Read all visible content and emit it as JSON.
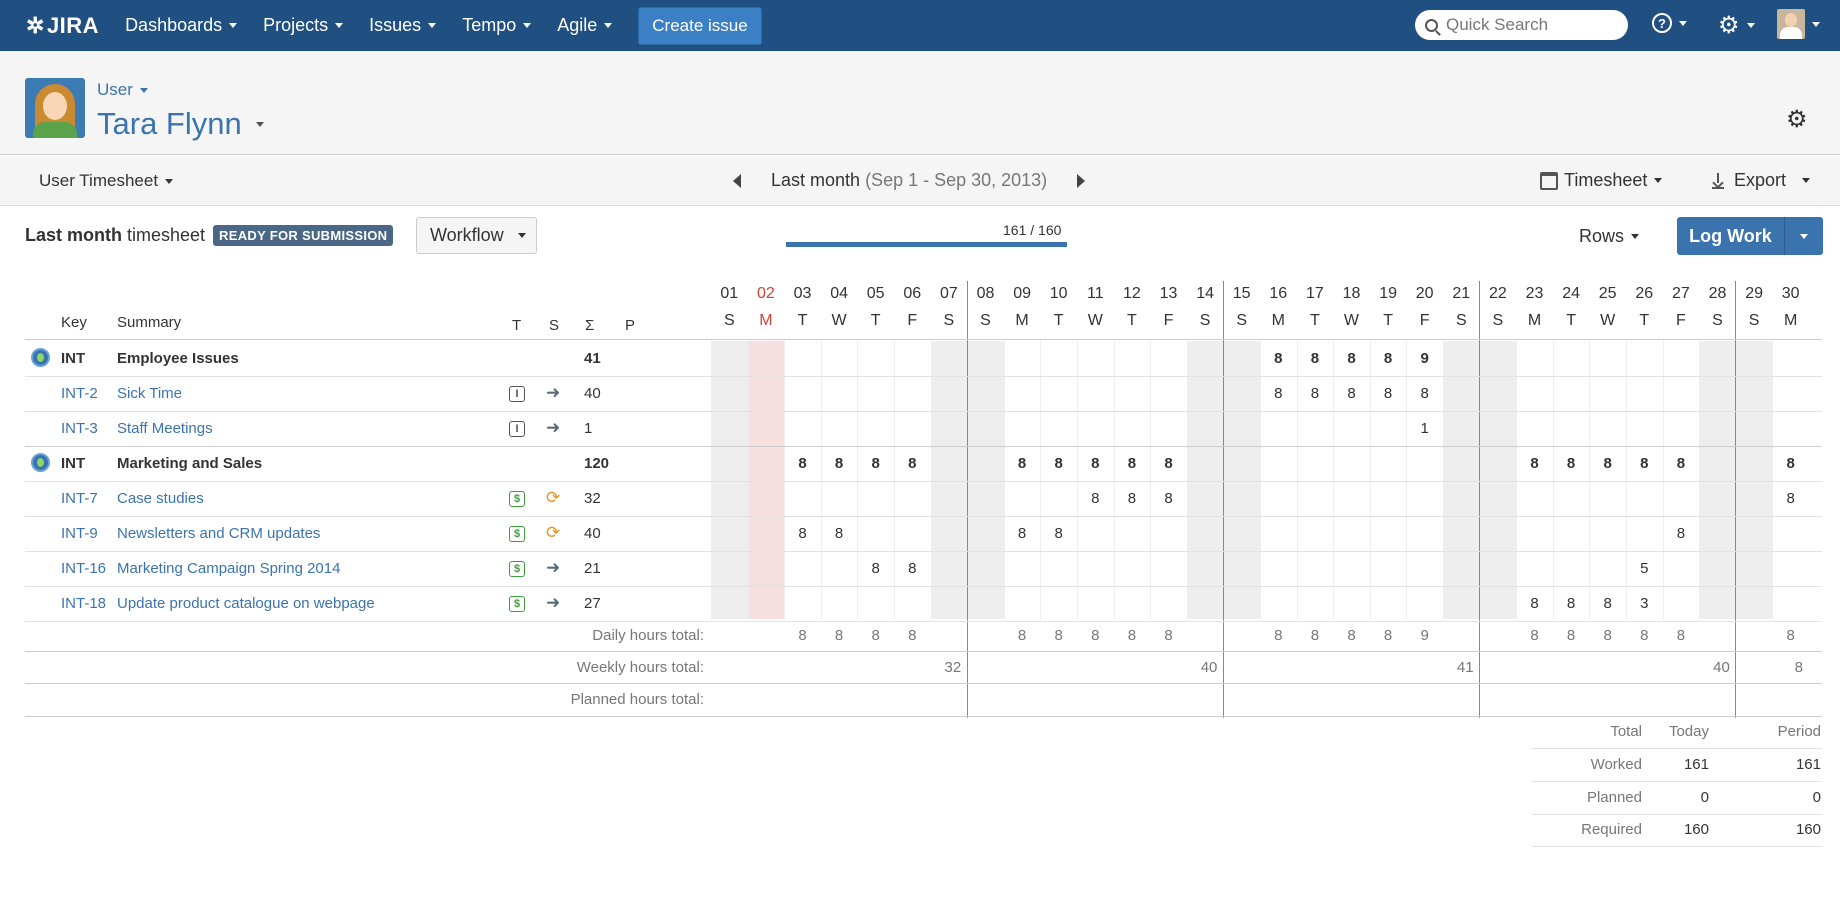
{
  "nav": {
    "logo": "JIRA",
    "items": [
      "Dashboards",
      "Projects",
      "Issues",
      "Tempo",
      "Agile"
    ],
    "create": "Create issue",
    "search_placeholder": "Quick Search"
  },
  "header": {
    "role": "User",
    "name": "Tara Flynn"
  },
  "subbar": {
    "view": "User Timesheet",
    "period": "Last month",
    "range": "(Sep 1 - Sep 30, 2013)",
    "timesheet": "Timesheet",
    "export": "Export"
  },
  "timesheet": {
    "title_bold": "Last month",
    "title_rest": "timesheet",
    "badge": "READY FOR SUBMISSION",
    "workflow": "Workflow",
    "progress_label": "161 / 160",
    "progress_fraction": 1.0,
    "rows_label": "Rows",
    "log_work": "Log Work"
  },
  "columns": {
    "key": "Key",
    "summary": "Summary",
    "t": "T",
    "s": "S",
    "sigma": "Σ",
    "p": "P"
  },
  "days": [
    {
      "d": "01",
      "w": "S",
      "type": "weekend"
    },
    {
      "d": "02",
      "w": "M",
      "type": "holiday"
    },
    {
      "d": "03",
      "w": "T"
    },
    {
      "d": "04",
      "w": "W"
    },
    {
      "d": "05",
      "w": "T"
    },
    {
      "d": "06",
      "w": "F"
    },
    {
      "d": "07",
      "w": "S",
      "type": "weekend"
    },
    {
      "d": "08",
      "w": "S",
      "type": "weekend"
    },
    {
      "d": "09",
      "w": "M"
    },
    {
      "d": "10",
      "w": "T"
    },
    {
      "d": "11",
      "w": "W"
    },
    {
      "d": "12",
      "w": "T"
    },
    {
      "d": "13",
      "w": "F"
    },
    {
      "d": "14",
      "w": "S",
      "type": "weekend"
    },
    {
      "d": "15",
      "w": "S",
      "type": "weekend"
    },
    {
      "d": "16",
      "w": "M"
    },
    {
      "d": "17",
      "w": "T"
    },
    {
      "d": "18",
      "w": "W"
    },
    {
      "d": "19",
      "w": "T"
    },
    {
      "d": "20",
      "w": "F"
    },
    {
      "d": "21",
      "w": "S",
      "type": "weekend"
    },
    {
      "d": "22",
      "w": "S",
      "type": "weekend"
    },
    {
      "d": "23",
      "w": "M"
    },
    {
      "d": "24",
      "w": "T"
    },
    {
      "d": "25",
      "w": "W"
    },
    {
      "d": "26",
      "w": "T"
    },
    {
      "d": "27",
      "w": "F"
    },
    {
      "d": "28",
      "w": "S",
      "type": "weekend"
    },
    {
      "d": "29",
      "w": "S",
      "type": "weekend"
    },
    {
      "d": "30",
      "w": "M"
    }
  ],
  "rows": [
    {
      "group": true,
      "key": "INT",
      "summary": "Employee Issues",
      "total": "41",
      "hours": {
        "16": "8",
        "17": "8",
        "18": "8",
        "19": "8",
        "20": "9"
      }
    },
    {
      "key": "INT-2",
      "summary": "Sick Time",
      "t": "I",
      "s": "person",
      "total": "40",
      "hours": {
        "16": "8",
        "17": "8",
        "18": "8",
        "19": "8",
        "20": "8"
      }
    },
    {
      "key": "INT-3",
      "summary": "Staff Meetings",
      "t": "I",
      "s": "person",
      "total": "1",
      "hours": {
        "20": "1"
      }
    },
    {
      "group": true,
      "key": "INT",
      "summary": "Marketing and Sales",
      "total": "120",
      "hours": {
        "03": "8",
        "04": "8",
        "05": "8",
        "06": "8",
        "09": "8",
        "10": "8",
        "11": "8",
        "12": "8",
        "13": "8",
        "23": "8",
        "24": "8",
        "25": "8",
        "26": "8",
        "27": "8",
        "30": "8"
      }
    },
    {
      "key": "INT-7",
      "summary": "Case studies",
      "t": "$",
      "s": "orange",
      "total": "32",
      "hours": {
        "11": "8",
        "12": "8",
        "13": "8",
        "30": "8"
      }
    },
    {
      "key": "INT-9",
      "summary": "Newsletters and CRM updates",
      "t": "$",
      "s": "orange",
      "total": "40",
      "hours": {
        "03": "8",
        "04": "8",
        "09": "8",
        "10": "8",
        "27": "8"
      }
    },
    {
      "key": "INT-16",
      "summary": "Marketing Campaign Spring 2014",
      "t": "$",
      "s": "person",
      "total": "21",
      "hours": {
        "05": "8",
        "06": "8",
        "26": "5"
      }
    },
    {
      "key": "INT-18",
      "summary": "Update product catalogue on webpage",
      "t": "$",
      "s": "person",
      "total": "27",
      "hours": {
        "23": "8",
        "24": "8",
        "25": "8",
        "26": "3"
      }
    }
  ],
  "footer": {
    "daily_label": "Daily hours total:",
    "weekly_label": "Weekly hours total:",
    "planned_label": "Planned hours total:",
    "daily": {
      "03": "8",
      "04": "8",
      "05": "8",
      "06": "8",
      "09": "8",
      "10": "8",
      "11": "8",
      "12": "8",
      "13": "8",
      "16": "8",
      "17": "8",
      "18": "8",
      "19": "8",
      "20": "9",
      "23": "8",
      "24": "8",
      "25": "8",
      "26": "8",
      "27": "8",
      "30": "8"
    },
    "weekly": [
      "32",
      "40",
      "41",
      "40",
      "8"
    ]
  },
  "summary": {
    "headers": [
      "Total",
      "Today",
      "Period"
    ],
    "rows": [
      {
        "label": "Worked",
        "today": "161",
        "period": "161"
      },
      {
        "label": "Planned",
        "today": "0",
        "period": "0"
      },
      {
        "label": "Required",
        "today": "160",
        "period": "160"
      }
    ]
  },
  "colors": {
    "nav": "#205081",
    "link": "#3b73af",
    "holiday": "#f7dfe0",
    "weekend": "#eeeeee",
    "holiday_text": "#d04437"
  }
}
